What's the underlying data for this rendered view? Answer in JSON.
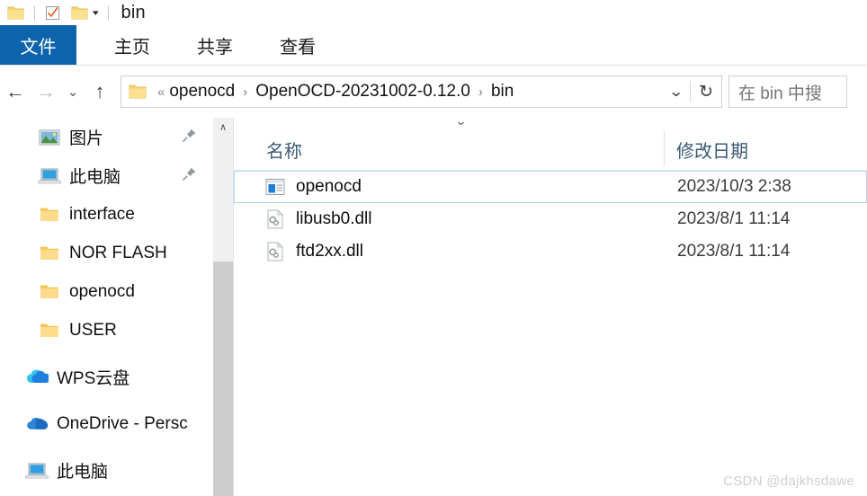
{
  "window": {
    "title": "bin"
  },
  "quick_access_toolbar": {
    "items": [
      {
        "icon": "folder-icon",
        "label": ""
      },
      {
        "icon": "checkbox-checked-icon",
        "label": ""
      },
      {
        "icon": "folder-icon",
        "label": ""
      },
      {
        "icon": "chevron-down-icon",
        "label": ""
      }
    ],
    "caret": "▾"
  },
  "ribbon": {
    "tabs": [
      {
        "id": "file",
        "label": "文件",
        "active": true
      },
      {
        "id": "home",
        "label": "主页",
        "active": false
      },
      {
        "id": "share",
        "label": "共享",
        "active": false
      },
      {
        "id": "view",
        "label": "查看",
        "active": false
      }
    ],
    "active_tab_color": "#0d64ad",
    "expand_caret": "⌄"
  },
  "navigation": {
    "back": "←",
    "forward": "→",
    "recent": "⌄",
    "up": "↑",
    "refresh": "↻",
    "dropdown": "⌄"
  },
  "address_bar": {
    "overflow": "«",
    "separator": "›",
    "crumbs": [
      "openocd",
      "OpenOCD-20231002-0.12.0",
      "bin"
    ]
  },
  "search": {
    "placeholder": "在 bin 中搜"
  },
  "sidebar": {
    "items": [
      {
        "icon": "pictures-icon",
        "label": "图片",
        "pinned": true
      },
      {
        "icon": "computer-icon",
        "label": "此电脑",
        "pinned": true
      },
      {
        "icon": "folder-icon",
        "label": "interface",
        "pinned": false
      },
      {
        "icon": "folder-icon",
        "label": "NOR FLASH",
        "pinned": false
      },
      {
        "icon": "folder-icon",
        "label": "openocd",
        "pinned": false
      },
      {
        "icon": "folder-icon",
        "label": "USER",
        "pinned": false
      },
      {
        "icon": "wps-cloud-icon",
        "label": "WPS云盘",
        "pinned": false
      },
      {
        "icon": "onedrive-icon",
        "label": "OneDrive - Persc",
        "pinned": false
      },
      {
        "icon": "computer-icon",
        "label": "此电脑",
        "pinned": false
      }
    ],
    "scroll_up_arrow": "∧"
  },
  "file_list": {
    "columns": [
      {
        "id": "name",
        "label": "名称"
      },
      {
        "id": "date",
        "label": "修改日期"
      }
    ],
    "rows": [
      {
        "icon": "application-icon",
        "name": "openocd",
        "date": "2023/10/3 2:38",
        "selected": true
      },
      {
        "icon": "dll-file-icon",
        "name": "libusb0.dll",
        "date": "2023/8/1 11:14",
        "selected": false
      },
      {
        "icon": "dll-file-icon",
        "name": "ftd2xx.dll",
        "date": "2023/8/1 11:14",
        "selected": false
      }
    ]
  },
  "watermark": {
    "text": "CSDN @dajkhsdawe"
  },
  "colors": {
    "accent_blue": "#0d64ad",
    "selection_border": "#a9d6f0",
    "folder_yellow": "#f7d06a",
    "header_text": "#3d5a75"
  }
}
